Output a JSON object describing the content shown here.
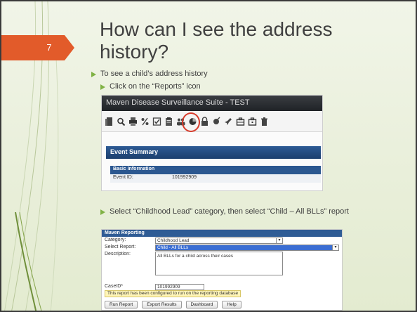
{
  "slide": {
    "page_number": "7",
    "title": "How can I see the address history?",
    "accent_color": "#e25b2a",
    "bullet_color": "#80b245"
  },
  "bullets": [
    {
      "text": "To see a child’s address history"
    },
    {
      "text": "Click on the “Reports” icon"
    },
    {
      "text": "Select “Childhood Lead” category, then select “Child – All BLLs” report"
    }
  ],
  "maven_window": {
    "title": "Maven Disease Surveillance Suite - TEST",
    "toolbar_icons": [
      "document-icon",
      "search-icon",
      "print-icon",
      "percent-icon",
      "checklist-icon",
      "clipboard-icon",
      "people-icon",
      "reports-icon",
      "lock-icon",
      "flask-icon",
      "pin-icon",
      "briefcase-icon",
      "briefcase-alt-icon",
      "trash-icon"
    ],
    "highlight_color": "#d83a2a",
    "event_summary_label": "Event Summary",
    "basic_information_label": "Basic Information",
    "event_id_label": "Event ID:",
    "event_id_value": "101992909"
  },
  "reporting_form": {
    "header": "Maven Reporting",
    "category_label": "Category:",
    "category_value": "Childhood Lead",
    "report_label": "Select Report:",
    "report_value": "Child - All BLLs",
    "description_label": "Description:",
    "description_value": "All BLLs for a child across their cases",
    "caseid_label": "CaseID*",
    "caseid_value": "101992909",
    "notice": "This report has been configured to run on the reporting database",
    "buttons": {
      "run": "Run Report",
      "export": "Export Results",
      "dashboard": "Dashboard",
      "help": "Help"
    }
  }
}
